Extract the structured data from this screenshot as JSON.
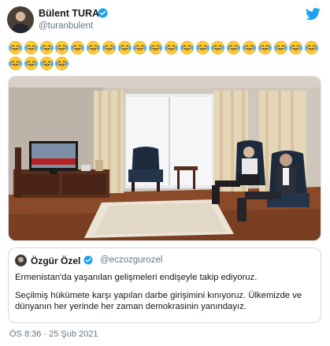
{
  "author": {
    "name": "Bülent TURAN",
    "handle": "@turanbulent",
    "avatar_icon": "profile-avatar"
  },
  "icons": {
    "verified": "verified-badge-icon",
    "brand": "twitter-bird-icon",
    "emoji": "face-with-tears-of-joy-emoji"
  },
  "emoji": {
    "row1_count": 20,
    "row2_count": 4,
    "glyph": "😂"
  },
  "media": {
    "scene": "tv-room-photo"
  },
  "quoted_tweet": {
    "name": "Özgür Özel",
    "handle": "@eczozgurozel",
    "paragraph_1": "Ermenistan'da yaşanılan gelişmeleri endişeyle takip ediyoruz.",
    "paragraph_2": "Seçilmiş hükümete karşı yapılan darbe girişimini kınıyoruz. Ülkemizde ve dünyanın her yerinde her zaman demokrasinin yanındayız."
  },
  "timestamp": "ÖS 8:36 · 25 Şub 2021",
  "colors": {
    "twitter_blue": "#1da1f2",
    "text_primary": "#14171a",
    "text_secondary": "#657786",
    "border": "#cfd9de"
  }
}
